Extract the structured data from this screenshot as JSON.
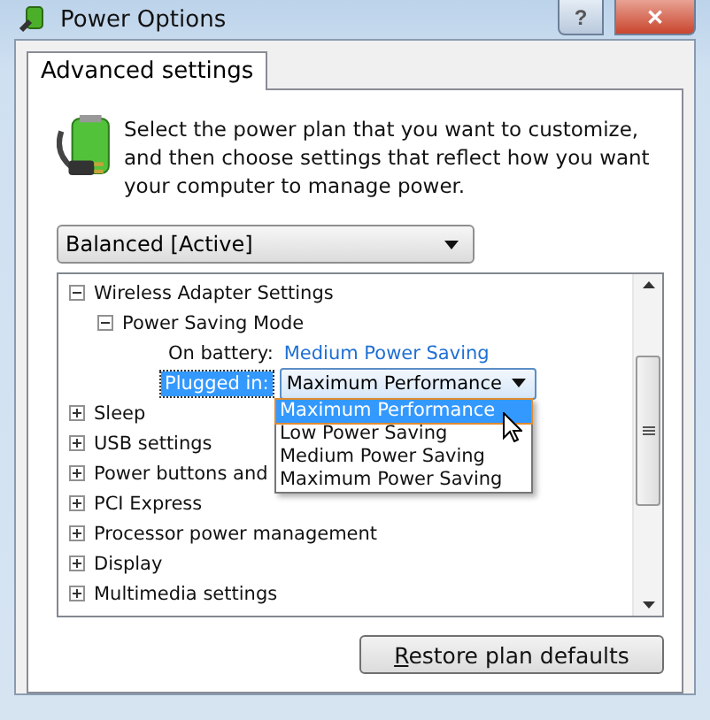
{
  "window": {
    "title": "Power Options",
    "buttons": [
      {
        "kind": "help",
        "label": "?"
      },
      {
        "kind": "close",
        "label": "✕"
      }
    ]
  },
  "tabs": [
    {
      "label": "Advanced settings",
      "selected": true
    }
  ],
  "intro": "Select the power plan that you want to customize, and then choose settings that reflect how you want your computer to manage power.",
  "plan_select": {
    "value": "Balanced [Active]"
  },
  "tree": [
    {
      "label": "Wireless Adapter Settings",
      "expanded": true,
      "children": [
        {
          "label": "Power Saving Mode",
          "expanded": true,
          "settings": [
            {
              "kind": "link",
              "label": "On battery:",
              "value": "Medium Power Saving",
              "selected": false
            },
            {
              "kind": "combo",
              "label": "Plugged in:",
              "value": "Maximum Performance",
              "selected": true,
              "options": [
                {
                  "label": "Maximum Performance",
                  "selected": true
                },
                {
                  "label": "Low Power Saving",
                  "selected": false
                },
                {
                  "label": "Medium Power Saving",
                  "selected": false
                },
                {
                  "label": "Maximum Power Saving",
                  "selected": false
                }
              ]
            }
          ]
        }
      ]
    },
    {
      "label": "Sleep",
      "expanded": false
    },
    {
      "label": "USB settings",
      "expanded": false
    },
    {
      "label": "Power buttons and",
      "expanded": false
    },
    {
      "label": "PCI Express",
      "expanded": false
    },
    {
      "label": "Processor power management",
      "expanded": false
    },
    {
      "label": "Display",
      "expanded": false
    },
    {
      "label": "Multimedia settings",
      "expanded": false
    }
  ],
  "restore_button": "Restore plan defaults"
}
